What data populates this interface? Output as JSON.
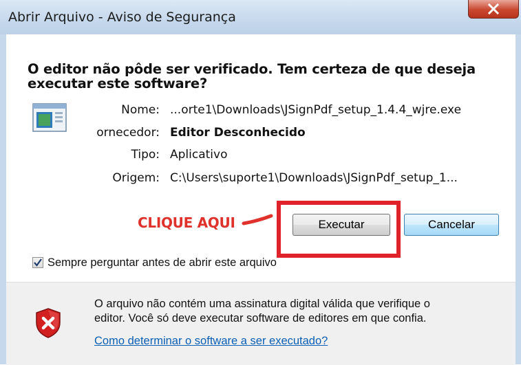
{
  "window": {
    "title": "Abrir Arquivo - Aviso de Segurança",
    "close_glyph": "X"
  },
  "dialog": {
    "heading_line1": "O editor não pôde ser verificado. Tem certeza de que deseja",
    "heading_line2": "executar este software?",
    "icon": "application-window-icon",
    "fields": [
      {
        "label": "Nome:",
        "value": "...orte1\\Downloads\\JSignPdf_setup_1.4.4_wjre.exe"
      },
      {
        "label": "ornecedor:",
        "value": "Editor Desconhecido"
      },
      {
        "label": "Tipo:",
        "value": "Aplicativo"
      },
      {
        "label": "Origem:",
        "value": "C:\\Users\\suporte1\\Downloads\\JSignPdf_setup_1..."
      }
    ]
  },
  "annotation": {
    "text": "CLIQUE AQUI",
    "color": "#e0322c",
    "highlight_color": "#e0232b"
  },
  "buttons": {
    "run": "Executar",
    "cancel": "Cancelar"
  },
  "checkbox": {
    "label": "Sempre perguntar antes de abrir este arquivo",
    "checked": true
  },
  "footer": {
    "warning_line1": "O arquivo não contém uma assinatura digital válida que verifique o",
    "warning_line2": "editor. Você só deve executar software de editores em que confia.",
    "link": "Como determinar o software a ser executado?",
    "icon": "shield-error-icon"
  },
  "colors": {
    "titlebar": "#c6d8ec",
    "link": "#0b5fb5",
    "close": "#c9472f"
  }
}
